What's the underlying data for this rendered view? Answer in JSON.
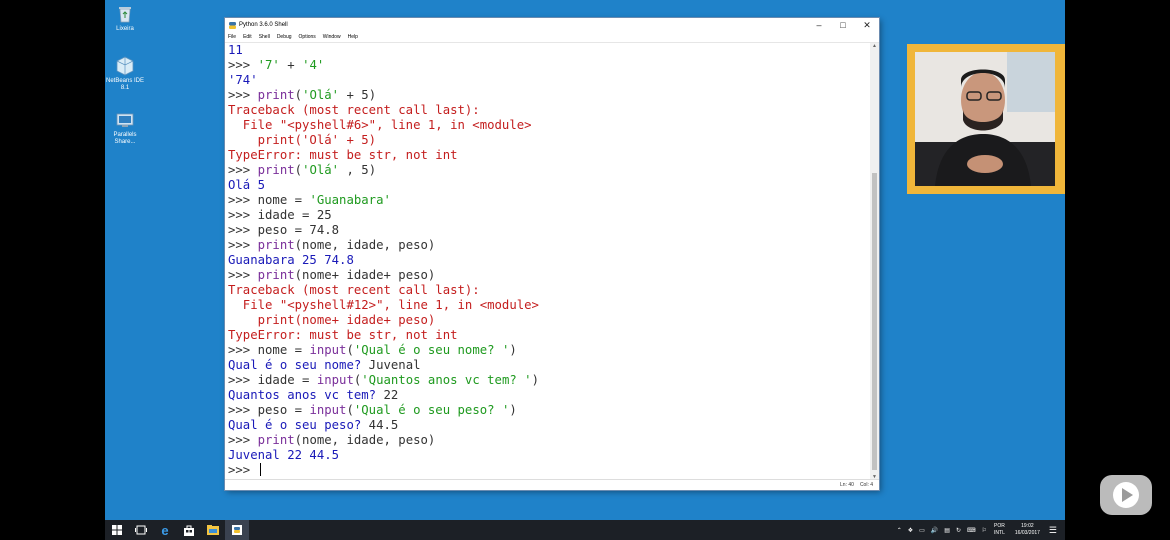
{
  "desktop_icons": [
    {
      "name": "Lixeira",
      "icon": "recycle-bin-icon"
    },
    {
      "name": "NetBeans IDE 8.1",
      "icon": "netbeans-icon"
    },
    {
      "name": "Parallels Share...",
      "icon": "parallels-share-icon"
    }
  ],
  "window": {
    "title": "Python 3.6.0 Shell",
    "menu": [
      "File",
      "Edit",
      "Shell",
      "Debug",
      "Options",
      "Window",
      "Help"
    ],
    "status": {
      "line": "Ln: 40",
      "col": "Col: 4"
    }
  },
  "shell": {
    "lines": [
      [
        {
          "t": "11",
          "c": "out"
        }
      ],
      [
        {
          "t": ">>> ",
          "c": "prm"
        },
        {
          "t": "'7'",
          "c": "str"
        },
        {
          "t": " + ",
          "c": "prm"
        },
        {
          "t": "'4'",
          "c": "str"
        }
      ],
      [
        {
          "t": "'74'",
          "c": "out"
        }
      ],
      [
        {
          "t": ">>> ",
          "c": "prm"
        },
        {
          "t": "print",
          "c": "blt"
        },
        {
          "t": "(",
          "c": "prm"
        },
        {
          "t": "'Olá'",
          "c": "str"
        },
        {
          "t": " + 5)",
          "c": "prm"
        }
      ],
      [
        {
          "t": "Traceback (most recent call last):",
          "c": "err"
        }
      ],
      [
        {
          "t": "  File \"<pyshell#6>\", line 1, in <module>",
          "c": "err"
        }
      ],
      [
        {
          "t": "    print('Olá' + 5)",
          "c": "err"
        }
      ],
      [
        {
          "t": "TypeError: must be str, not int",
          "c": "err"
        }
      ],
      [
        {
          "t": ">>> ",
          "c": "prm"
        },
        {
          "t": "print",
          "c": "blt"
        },
        {
          "t": "(",
          "c": "prm"
        },
        {
          "t": "'Olá'",
          "c": "str"
        },
        {
          "t": " , 5)",
          "c": "prm"
        }
      ],
      [
        {
          "t": "Olá 5",
          "c": "out"
        }
      ],
      [
        {
          "t": ">>> nome = ",
          "c": "prm"
        },
        {
          "t": "'Guanabara'",
          "c": "str"
        }
      ],
      [
        {
          "t": ">>> idade = 25",
          "c": "prm"
        }
      ],
      [
        {
          "t": ">>> peso = 74.8",
          "c": "prm"
        }
      ],
      [
        {
          "t": ">>> ",
          "c": "prm"
        },
        {
          "t": "print",
          "c": "blt"
        },
        {
          "t": "(nome, idade, peso)",
          "c": "prm"
        }
      ],
      [
        {
          "t": "Guanabara 25 74.8",
          "c": "out"
        }
      ],
      [
        {
          "t": ">>> ",
          "c": "prm"
        },
        {
          "t": "print",
          "c": "blt"
        },
        {
          "t": "(nome+ idade+ peso)",
          "c": "prm"
        }
      ],
      [
        {
          "t": "Traceback (most recent call last):",
          "c": "err"
        }
      ],
      [
        {
          "t": "  File \"<pyshell#12>\", line 1, in <module>",
          "c": "err"
        }
      ],
      [
        {
          "t": "    print(nome+ idade+ peso)",
          "c": "err"
        }
      ],
      [
        {
          "t": "TypeError: must be str, not int",
          "c": "err"
        }
      ],
      [
        {
          "t": ">>> nome = ",
          "c": "prm"
        },
        {
          "t": "input",
          "c": "blt"
        },
        {
          "t": "(",
          "c": "prm"
        },
        {
          "t": "'Qual é o seu nome? '",
          "c": "str"
        },
        {
          "t": ")",
          "c": "prm"
        }
      ],
      [
        {
          "t": "Qual é o seu nome? ",
          "c": "out"
        },
        {
          "t": "Juvenal",
          "c": "prm"
        }
      ],
      [
        {
          "t": ">>> idade = ",
          "c": "prm"
        },
        {
          "t": "input",
          "c": "blt"
        },
        {
          "t": "(",
          "c": "prm"
        },
        {
          "t": "'Quantos anos vc tem? '",
          "c": "str"
        },
        {
          "t": ")",
          "c": "prm"
        }
      ],
      [
        {
          "t": "Quantos anos vc tem? ",
          "c": "out"
        },
        {
          "t": "22",
          "c": "prm"
        }
      ],
      [
        {
          "t": ">>> peso = ",
          "c": "prm"
        },
        {
          "t": "input",
          "c": "blt"
        },
        {
          "t": "(",
          "c": "prm"
        },
        {
          "t": "'Qual é o seu peso? '",
          "c": "str"
        },
        {
          "t": ")",
          "c": "prm"
        }
      ],
      [
        {
          "t": "Qual é o seu peso? ",
          "c": "out"
        },
        {
          "t": "44.5",
          "c": "prm"
        }
      ],
      [
        {
          "t": ">>> ",
          "c": "prm"
        },
        {
          "t": "print",
          "c": "blt"
        },
        {
          "t": "(nome, idade, peso)",
          "c": "prm"
        }
      ],
      [
        {
          "t": "Juvenal 22 44.5",
          "c": "out"
        }
      ],
      [
        {
          "t": ">>> ",
          "c": "prm"
        }
      ]
    ]
  },
  "taskbar": {
    "apps": [
      "windows-start-icon",
      "task-view-icon",
      "edge-icon",
      "store-icon",
      "file-explorer-icon",
      "python-idle-icon"
    ],
    "language": {
      "top": "POR",
      "bottom": "INTL"
    },
    "clock": {
      "time": "19:02",
      "date": "16/03/2017"
    }
  },
  "colors": {
    "desktop": "#1f82c9",
    "webcam_frame": "#f0b63a",
    "error": "#c41e1e",
    "output": "#1a1ab8",
    "string": "#1f9a1f",
    "builtin": "#7a2f9a"
  }
}
